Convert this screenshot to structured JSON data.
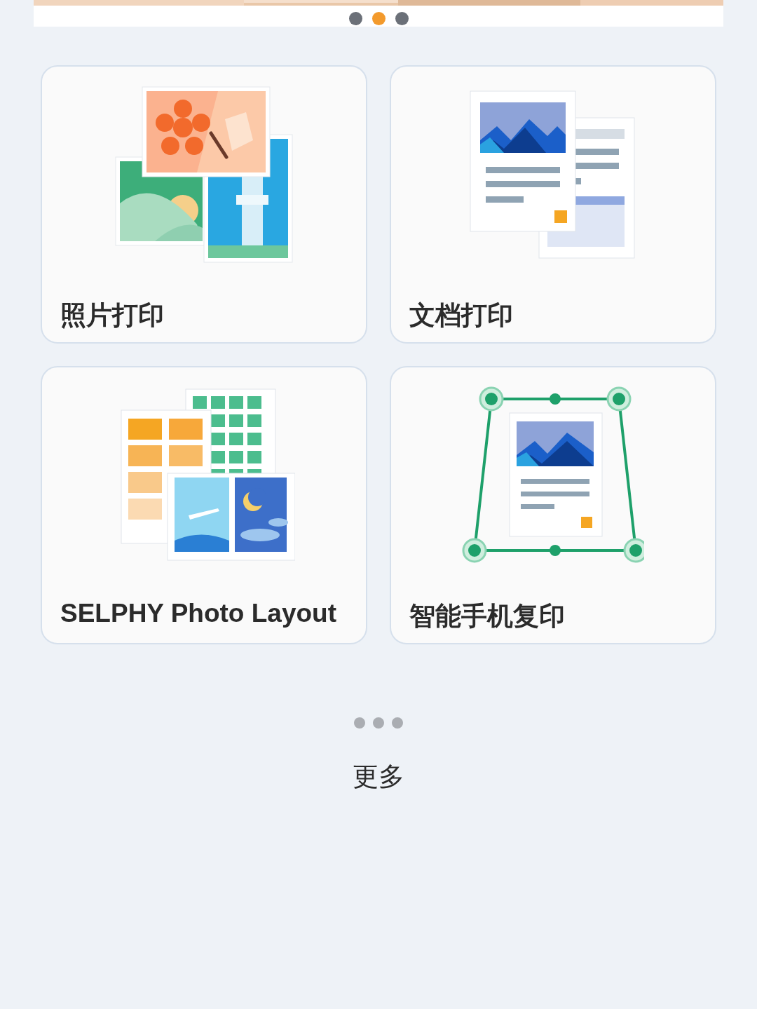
{
  "carousel": {
    "dots": [
      {
        "selected": false
      },
      {
        "selected": true
      },
      {
        "selected": false
      }
    ]
  },
  "tiles": [
    {
      "label": "照片打印"
    },
    {
      "label": "文档打印",
      "kind": "document"
    },
    {
      "label": "SELPHY Photo Layout",
      "kind": "layout"
    },
    {
      "label": "智能手机复印",
      "kind": "copy"
    }
  ],
  "more": {
    "label": "更多"
  }
}
